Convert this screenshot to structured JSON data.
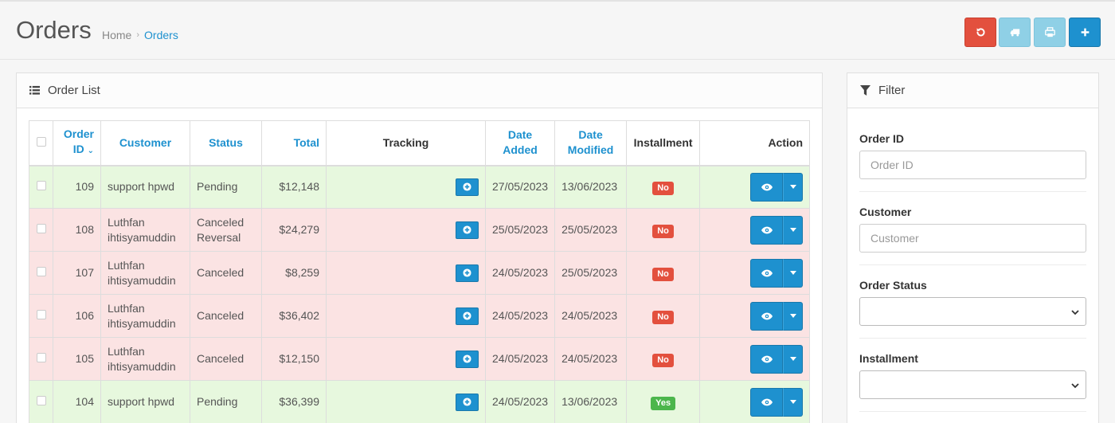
{
  "header": {
    "title": "Orders",
    "breadcrumb": [
      "Home",
      "Orders"
    ],
    "breadcrumb_separator": "›",
    "buttons": [
      {
        "name": "reset-icon",
        "color": "#e3503e"
      },
      {
        "name": "truck-icon",
        "color": "#8fd0e6"
      },
      {
        "name": "print-icon",
        "color": "#8fd0e6"
      },
      {
        "name": "plus-icon",
        "color": "#1e91cf"
      }
    ]
  },
  "order_list": {
    "heading": "Order List",
    "columns": {
      "order_id_1": "Order",
      "order_id_2": "ID",
      "customer": "Customer",
      "status": "Status",
      "total": "Total",
      "tracking": "Tracking",
      "date_added_1": "Date",
      "date_added_2": "Added",
      "date_modified_1": "Date",
      "date_modified_2": "Modified",
      "installment": "Installment",
      "action": "Action"
    },
    "rows": [
      {
        "id": "109",
        "customer_1": "support hpwd",
        "customer_2": "",
        "status_1": "Pending",
        "status_2": "",
        "total": "$12,148",
        "date_added": "27/05/2023",
        "date_modified": "13/06/2023",
        "installment": "No",
        "row_state": "pending"
      },
      {
        "id": "108",
        "customer_1": "Luthfan",
        "customer_2": "ihtisyamuddin",
        "status_1": "Canceled",
        "status_2": "Reversal",
        "total": "$24,279",
        "date_added": "25/05/2023",
        "date_modified": "25/05/2023",
        "installment": "No",
        "row_state": "canceled"
      },
      {
        "id": "107",
        "customer_1": "Luthfan",
        "customer_2": "ihtisyamuddin",
        "status_1": "Canceled",
        "status_2": "",
        "total": "$8,259",
        "date_added": "24/05/2023",
        "date_modified": "25/05/2023",
        "installment": "No",
        "row_state": "canceled"
      },
      {
        "id": "106",
        "customer_1": "Luthfan",
        "customer_2": "ihtisyamuddin",
        "status_1": "Canceled",
        "status_2": "",
        "total": "$36,402",
        "date_added": "24/05/2023",
        "date_modified": "24/05/2023",
        "installment": "No",
        "row_state": "canceled"
      },
      {
        "id": "105",
        "customer_1": "Luthfan",
        "customer_2": "ihtisyamuddin",
        "status_1": "Canceled",
        "status_2": "",
        "total": "$12,150",
        "date_added": "24/05/2023",
        "date_modified": "24/05/2023",
        "installment": "No",
        "row_state": "canceled"
      },
      {
        "id": "104",
        "customer_1": "support hpwd",
        "customer_2": "",
        "status_1": "Pending",
        "status_2": "",
        "total": "$36,399",
        "date_added": "24/05/2023",
        "date_modified": "13/06/2023",
        "installment": "Yes",
        "row_state": "pending"
      }
    ]
  },
  "filter": {
    "heading": "Filter",
    "order_id_label": "Order ID",
    "order_id_placeholder": "Order ID",
    "customer_label": "Customer",
    "customer_placeholder": "Customer",
    "order_status_label": "Order Status",
    "installment_label": "Installment"
  },
  "colors": {
    "accent": "#1e91cf",
    "danger": "#e3503e",
    "success": "#4cb64c",
    "pending_row": "#e7f8de",
    "canceled_row": "#fbe3e3"
  }
}
